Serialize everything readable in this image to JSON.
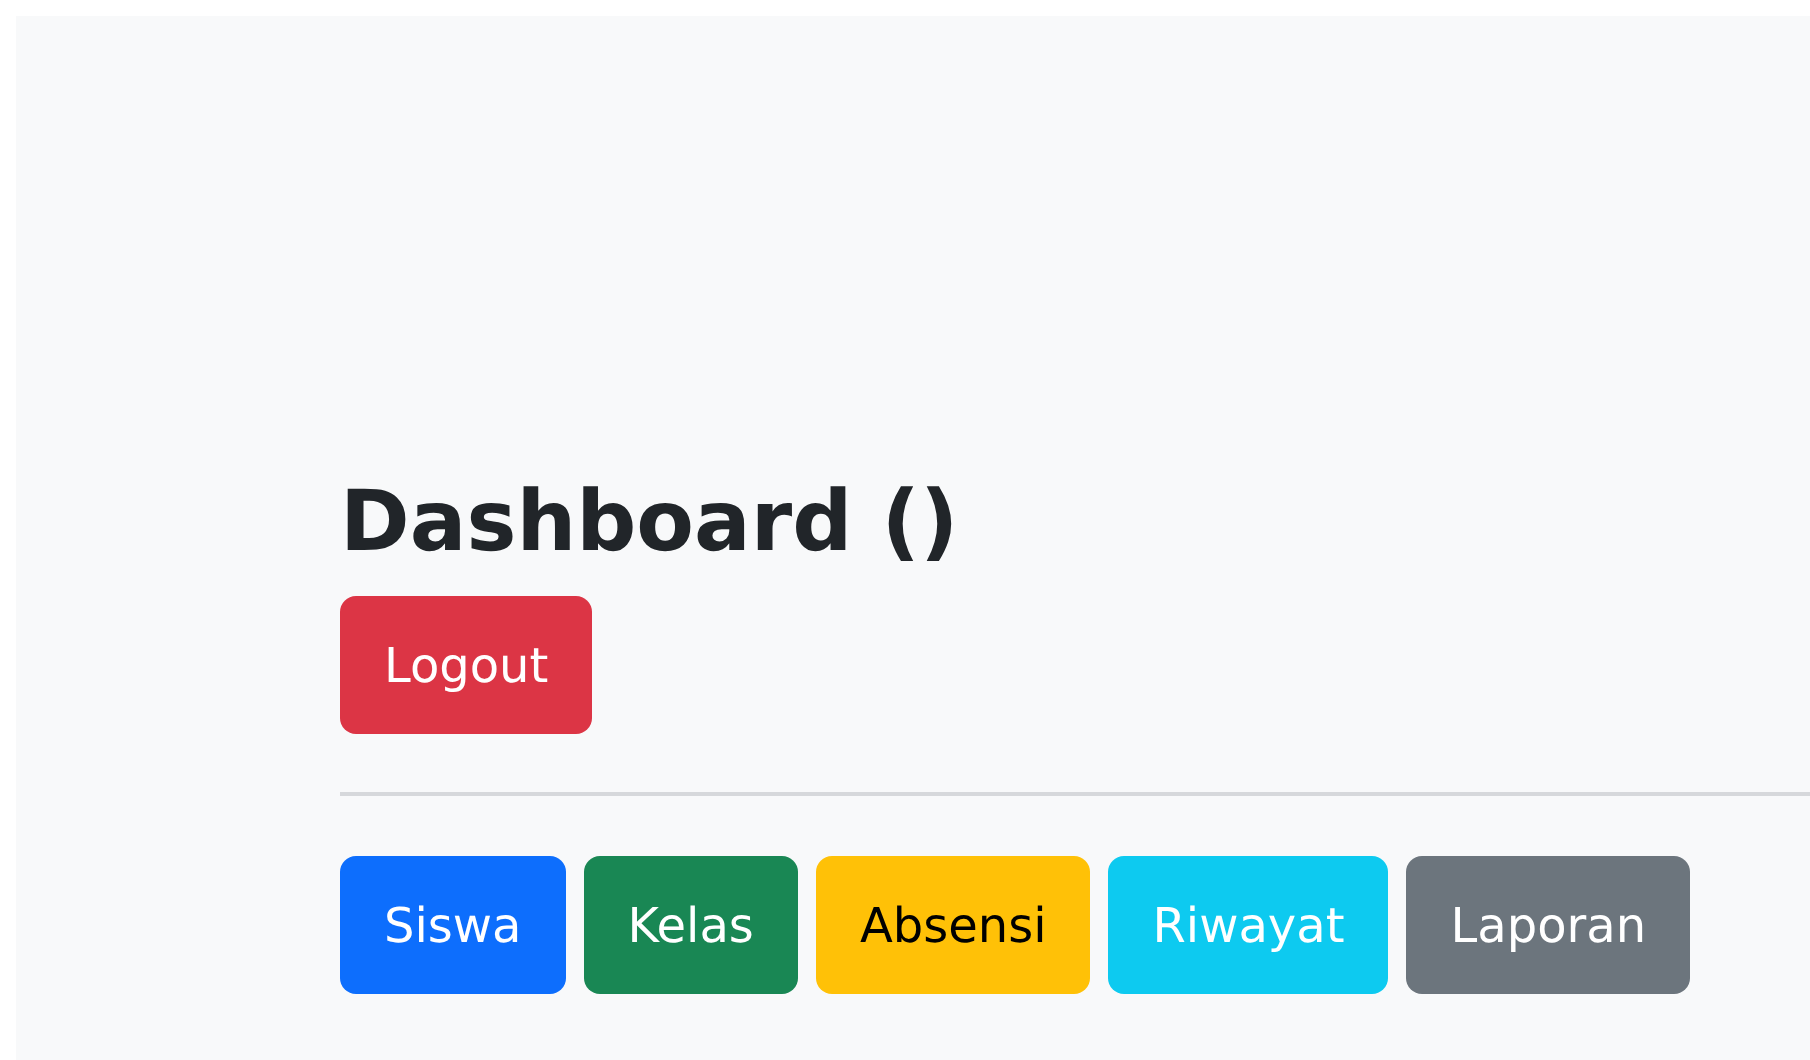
{
  "heading": "Dashboard ()",
  "logout": {
    "label": "Logout",
    "color": "#dc3545"
  },
  "nav_buttons": [
    {
      "label": "Siswa",
      "color": "#0d6efd"
    },
    {
      "label": "Kelas",
      "color": "#198754"
    },
    {
      "label": "Absensi",
      "color": "#ffc107"
    },
    {
      "label": "Riwayat",
      "color": "#0dcaf0"
    },
    {
      "label": "Laporan",
      "color": "#6c757d"
    }
  ]
}
